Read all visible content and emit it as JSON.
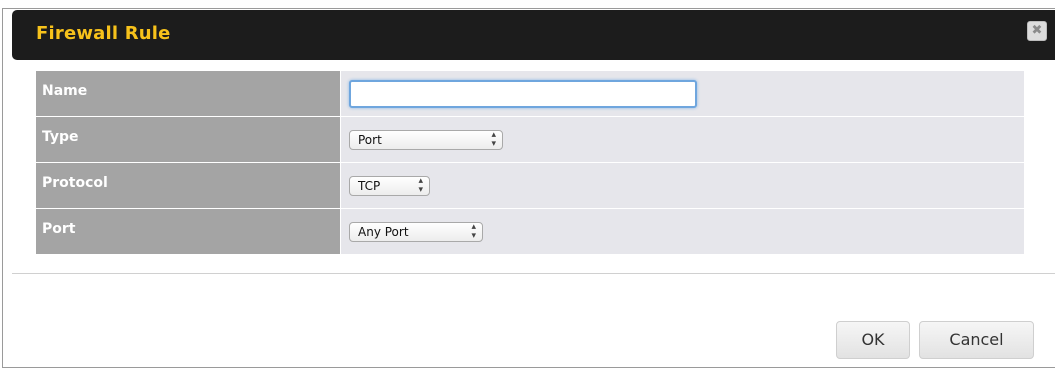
{
  "dialog": {
    "title": "Firewall Rule",
    "close_icon": "close-icon"
  },
  "form": {
    "rows": [
      {
        "label": "Name",
        "value": "",
        "control": "text-input"
      },
      {
        "label": "Type",
        "value": "Port",
        "control": "select"
      },
      {
        "label": "Protocol",
        "value": "TCP",
        "control": "select"
      },
      {
        "label": "Port",
        "value": "Any Port",
        "control": "select"
      }
    ]
  },
  "buttons": {
    "ok": "OK",
    "cancel": "Cancel"
  },
  "colors": {
    "title": "#f7c21b",
    "titlebar": "#1c1c1c",
    "label_bg": "#a4a4a4",
    "value_bg": "#e6e6eb",
    "focus_border": "#6fa6de"
  }
}
